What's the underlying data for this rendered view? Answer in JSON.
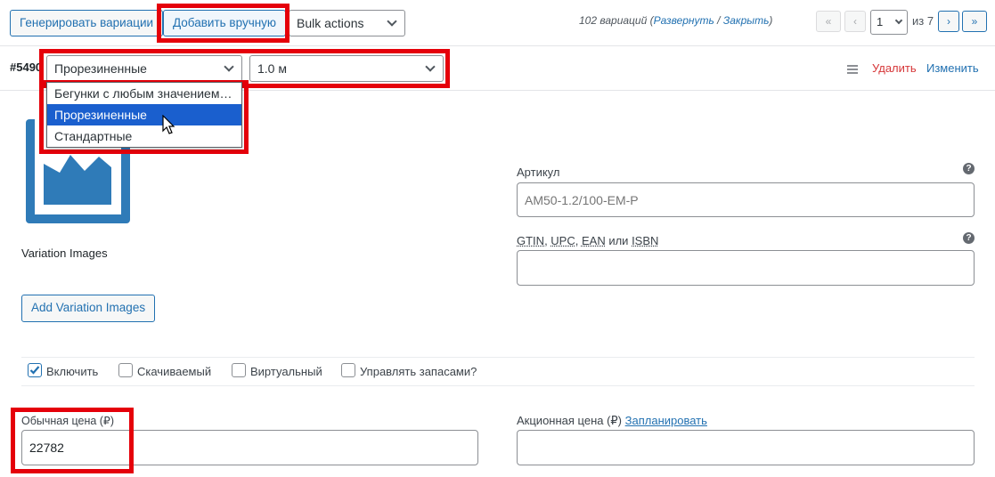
{
  "toolbar": {
    "generate_label": "Генерировать вариации",
    "add_manual_label": "Добавить вручную",
    "bulk_actions_value": "Bulk actions"
  },
  "pagination": {
    "count_text": "102 вариаций (",
    "expand_label": "Развернуть",
    "sep": " / ",
    "collapse_label": "Закрыть",
    "count_close": ")",
    "first": "«",
    "prev": "‹",
    "current_page": "1",
    "of_text": "из 7",
    "next": "›",
    "last": "»"
  },
  "variation": {
    "id": "#5490",
    "attribute_1_value": "Прорезиненные",
    "attribute_2_value": "1.0 м",
    "dropdown_options": [
      "Бегунки с любым значением…",
      "Прорезиненные",
      "Стандартные"
    ],
    "dropdown_selected_index": 1,
    "delete_label": "Удалить",
    "edit_label": "Изменить"
  },
  "images": {
    "title": "Variation Images",
    "add_button": "Add Variation Images"
  },
  "fields": {
    "sku_label": "Артикул",
    "sku_placeholder": "AM50-1.2/100-EM-P",
    "gtin_label_parts": [
      "GTIN",
      ", ",
      "UPC",
      ", ",
      "EAN",
      " или ",
      "ISBN"
    ],
    "gtin_value": "",
    "regular_price_label": "Обычная цена (₽)",
    "regular_price_value": "22782",
    "sale_price_label": "Акционная цена (₽) ",
    "schedule_link": "Запланировать",
    "sale_price_value": ""
  },
  "options": {
    "enable": "Включить",
    "enable_checked": true,
    "downloadable": "Скачиваемый",
    "virtual": "Виртуальный",
    "manage_stock": "Управлять запасами?"
  },
  "colors": {
    "accent": "#2271b1",
    "delete": "#d63638",
    "highlight_box": "#e5000a",
    "dropdown_selected": "#1a5fce"
  }
}
